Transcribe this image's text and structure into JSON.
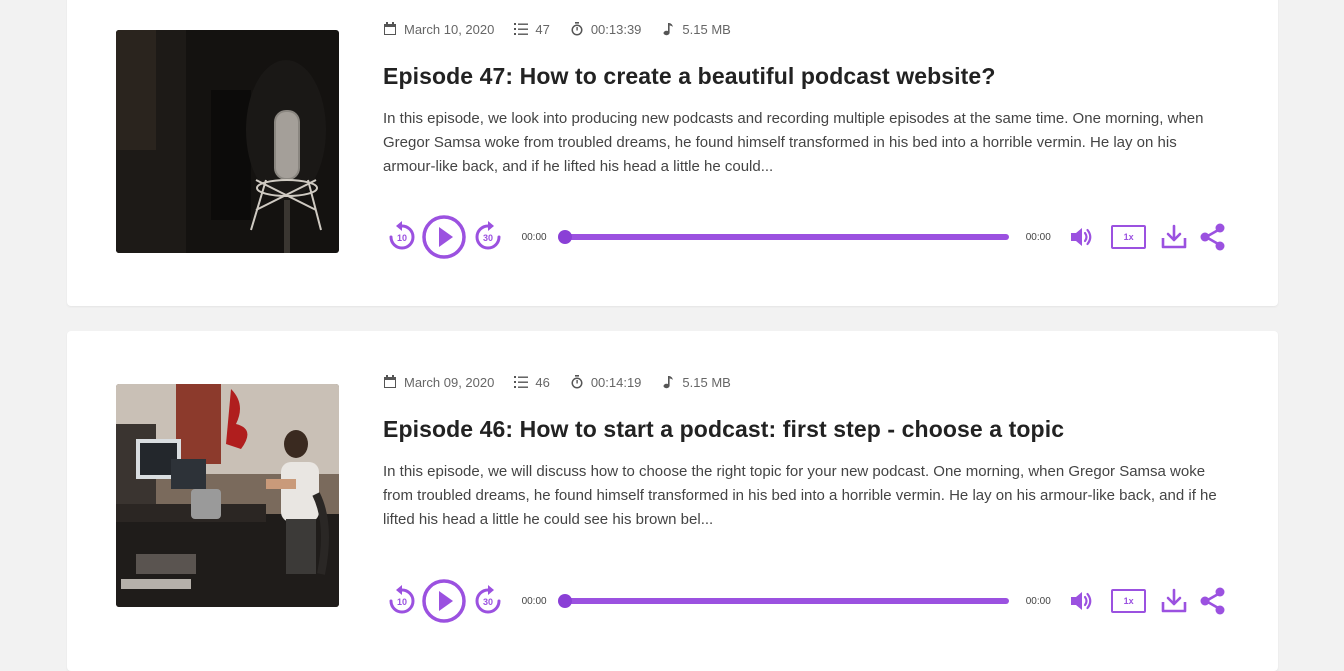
{
  "accent_color": "#9b51e0",
  "episodes": [
    {
      "date": "March 10, 2020",
      "number": "47",
      "duration": "00:13:39",
      "size": "5.15 MB",
      "title": "Episode 47: How to create a beautiful podcast website?",
      "description": "In this episode, we look into producing new podcasts and recording multiple episodes at the same time. One morning, when Gregor Samsa woke from troubled dreams, he found himself transformed in his bed into a horrible vermin. He lay on his armour-like back, and if he lifted his head a little he could...",
      "player": {
        "rewind_label": "10",
        "forward_label": "30",
        "current_time": "00:00",
        "total_time": "00:00",
        "speed": "1x",
        "progress": 0
      }
    },
    {
      "date": "March 09, 2020",
      "number": "46",
      "duration": "00:14:19",
      "size": "5.15 MB",
      "title": "Episode 46: How to start a podcast: first step - choose a topic",
      "description": "In this episode, we will discuss how to choose the right topic for your new podcast. One morning, when Gregor Samsa woke from troubled dreams, he found himself transformed in his bed into a horrible vermin. He lay on his armour-like back, and if he lifted his head a little he could see his brown bel...",
      "player": {
        "rewind_label": "10",
        "forward_label": "30",
        "current_time": "00:00",
        "total_time": "00:00",
        "speed": "1x",
        "progress": 0
      }
    }
  ]
}
